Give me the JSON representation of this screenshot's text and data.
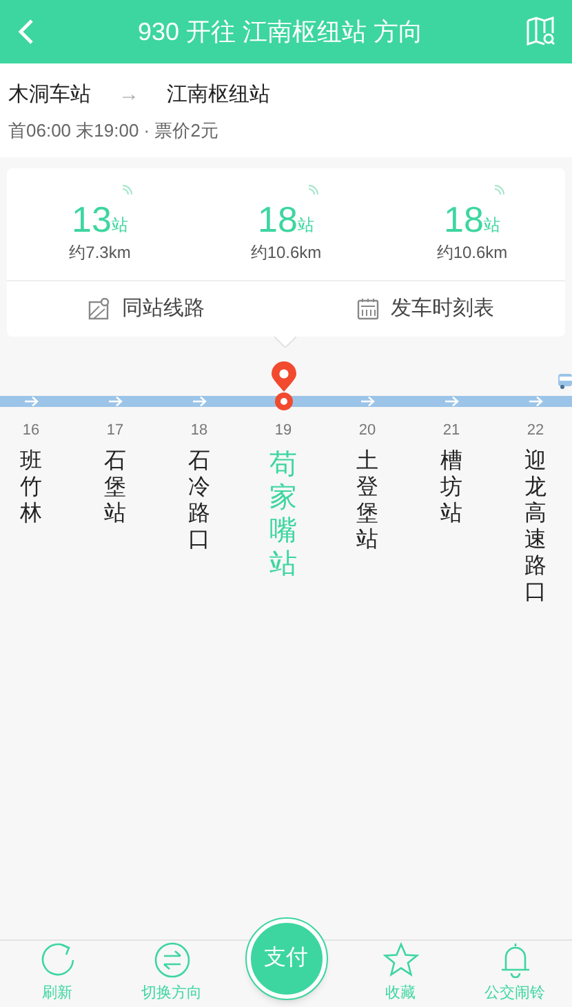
{
  "header": {
    "title": "930 开往 江南枢纽站 方向"
  },
  "route": {
    "from": "木洞车站",
    "arrow": "→",
    "to": "江南枢纽站",
    "info": "首06:00 末19:00 · 票价2元"
  },
  "arrivals": [
    {
      "stops": "13",
      "unit": "站",
      "distance": "约7.3km"
    },
    {
      "stops": "18",
      "unit": "站",
      "distance": "约10.6km"
    },
    {
      "stops": "18",
      "unit": "站",
      "distance": "约10.6km"
    }
  ],
  "actions": [
    {
      "kind": "map",
      "label": "同站线路"
    },
    {
      "kind": "calendar",
      "label": "发车时刻表"
    }
  ],
  "stations": [
    {
      "number": "16",
      "name": "班竹林",
      "selected": false
    },
    {
      "number": "17",
      "name": "石堡站",
      "selected": false
    },
    {
      "number": "18",
      "name": "石冷路口",
      "selected": false
    },
    {
      "number": "19",
      "name": "苟家嘴站",
      "selected": true
    },
    {
      "number": "20",
      "name": "土登堡站",
      "selected": false
    },
    {
      "number": "21",
      "name": "槽坊站",
      "selected": false
    },
    {
      "number": "22",
      "name": "迎龙高速路口",
      "selected": false
    }
  ],
  "tabbar": [
    {
      "kind": "refresh",
      "label": "刷新"
    },
    {
      "kind": "swap",
      "label": "切换方向"
    },
    {
      "kind": "pay",
      "label": "支付"
    },
    {
      "kind": "star",
      "label": "收藏"
    },
    {
      "kind": "bell",
      "label": "公交闹铃"
    }
  ]
}
